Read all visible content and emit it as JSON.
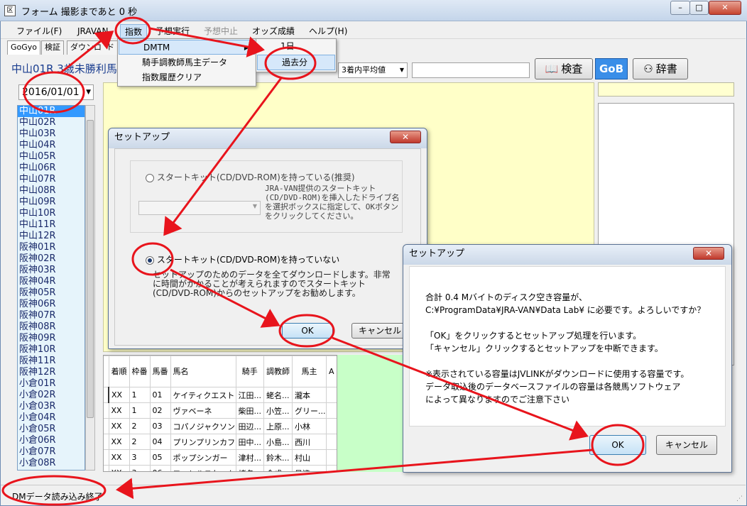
{
  "window": {
    "title": "フォーム 撮影まであと 0 秒",
    "icon_text": "区",
    "buttons": [
      "–",
      "□",
      "✕"
    ]
  },
  "menubar": {
    "items": [
      "ファイル(F)",
      "JRAVAN",
      "指数",
      "予想実行",
      "予想中止",
      "オッズ成績",
      "ヘルプ(H)"
    ]
  },
  "tabs": [
    "GoGyo",
    "検証",
    "ダウンロ",
    "ド"
  ],
  "race": {
    "info": "中山01R 3歳未勝利馬",
    "date": "2016/01/01",
    "list": [
      "中山01R",
      "中山02R",
      "中山03R",
      "中山04R",
      "中山05R",
      "中山06R",
      "中山07R",
      "中山08R",
      "中山09R",
      "中山10R",
      "中山11R",
      "中山12R",
      "阪神01R",
      "阪神02R",
      "阪神03R",
      "阪神04R",
      "阪神05R",
      "阪神06R",
      "阪神07R",
      "阪神08R",
      "阪神09R",
      "阪神10R",
      "阪神11R",
      "阪神12R",
      "小倉01R",
      "小倉02R",
      "小倉03R",
      "小倉04R",
      "小倉05R",
      "小倉06R",
      "小倉07R",
      "小倉08R"
    ]
  },
  "toolbar": {
    "avg_select": "3着内平均値",
    "search_value": "",
    "kensa_label": "検査",
    "gob_label": "GoB",
    "jisho_label": "辞書"
  },
  "dropdown_menu": {
    "items": [
      "DMTM",
      "騎手調教師馬主データ",
      "指数履歴クリア"
    ],
    "submenu_arrow": "▶",
    "submenu_items": [
      "1日",
      "過去分"
    ]
  },
  "setup_dialog_1": {
    "title": "セットアップ",
    "close": "✕",
    "option1_label": "スタートキット(CD/DVD-ROM)を持っている(推奨)",
    "option1_desc": "JRA-VAN提供のスタートキット(CD/DVD-ROM)を挿入したドライブ名を選択ボックスに指定して、OKボタンをクリックしてください。",
    "option2_label": "スタートキット(CD/DVD-ROM)を持っていない",
    "option2_desc": "セットアップのためのデータを全てダウンロードします。非常に時間がかかることが考えられますのでスタートキット(CD/DVD-ROM)からのセットアップをお勧めします。",
    "ok_label": "OK",
    "cancel_label": "キャンセル"
  },
  "setup_dialog_2": {
    "title": "セットアップ",
    "close": "✕",
    "lines": [
      "合計 0.4 Mバイトのディスク空き容量が、",
      "C:¥ProgramData¥JRA-VAN¥Data Lab¥ に必要です。よろしいですか？",
      "",
      "「OK」をクリックするとセットアップ処理を行います。",
      "「キャンセル」クリックするとセットアップを中断できます。",
      "",
      "※表示されている容量はJVLINKがダウンロードに使用する容量です。",
      "データ取込後のデータベースファイルの容量は各競馬ソフトウェア",
      "によって異なりますのでご注意下さい"
    ],
    "ok_label": "OK",
    "cancel_label": "キャンセル"
  },
  "grid": {
    "headers": [
      "着順",
      "枠番",
      "馬番",
      "馬名",
      "騎手",
      "調教師",
      "馬主",
      "A"
    ],
    "rows": [
      [
        "XX",
        "1",
        "01",
        "ケイティクエスト",
        "江田...",
        "蛯名...",
        "瀧本",
        ""
      ],
      [
        "XX",
        "1",
        "02",
        "ヴァベーネ",
        "柴田...",
        "小笠...",
        "グリー...",
        ""
      ],
      [
        "XX",
        "2",
        "03",
        "コパノジャクソン",
        "田辺...",
        "上原...",
        "小林",
        ""
      ],
      [
        "XX",
        "2",
        "04",
        "プリンプリンカフェ",
        "田中...",
        "小島...",
        "西川",
        ""
      ],
      [
        "XX",
        "3",
        "05",
        "ポップシンガー",
        "津村...",
        "鈴木...",
        "村山",
        ""
      ],
      [
        "XX",
        "3",
        "06",
        "フォレルスケット",
        "蛯名...",
        "金成...",
        "日進",
        ""
      ]
    ]
  },
  "status": {
    "text": "DMデータ読み込み終了"
  }
}
